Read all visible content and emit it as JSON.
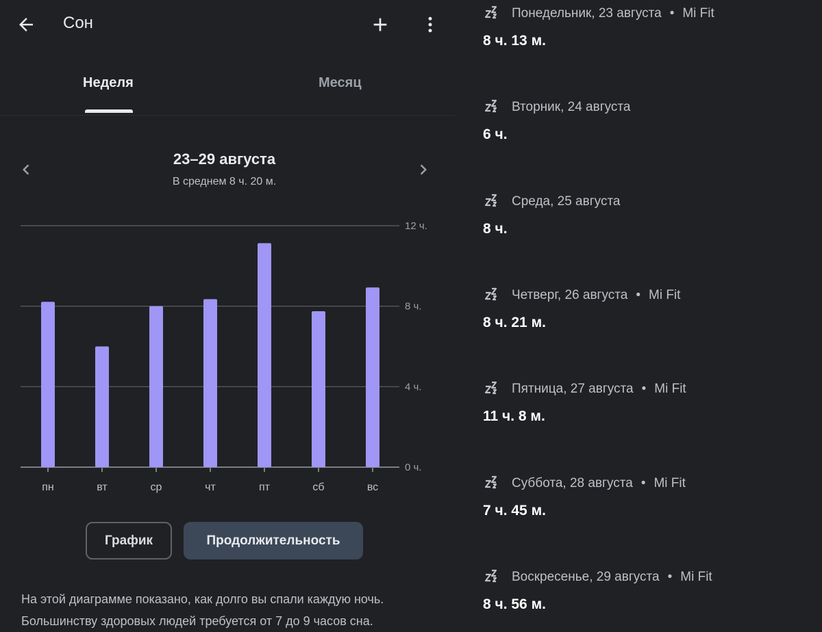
{
  "header": {
    "title": "Сон",
    "back_icon": "arrow-left-icon",
    "add_icon": "plus-icon",
    "more_icon": "more-vert-icon"
  },
  "tabs": [
    {
      "label": "Неделя",
      "selected": true
    },
    {
      "label": "Месяц",
      "selected": false
    }
  ],
  "period": {
    "range": "23–29 августа",
    "average": "В среднем 8 ч. 20 м."
  },
  "chart_data": {
    "type": "bar",
    "categories": [
      "пн",
      "вт",
      "ср",
      "чт",
      "пт",
      "сб",
      "вс"
    ],
    "values": [
      8.217,
      6.0,
      8.0,
      8.35,
      11.133,
      7.75,
      8.933
    ],
    "y_ticks": [
      "12 ч.",
      "8 ч.",
      "4 ч.",
      "0 ч."
    ],
    "y_tick_values": [
      12,
      8,
      4,
      0
    ],
    "ylim": [
      0,
      12
    ],
    "bar_color": "#a096f5",
    "grid_color": "#5f6368",
    "grid": true
  },
  "segmented": {
    "graph_label": "График",
    "duration_label": "Продолжительность",
    "selected": "duration"
  },
  "description": {
    "line1": "На этой диаграмме показано, как долго вы спали каждую ночь.",
    "line2": "Большинству здоровых людей требуется от 7 до 9 часов сна."
  },
  "entries": [
    {
      "date": "Понедельник, 23 августа",
      "source": "Mi Fit",
      "duration": "8 ч. 13 м."
    },
    {
      "date": "Вторник, 24 августа",
      "source": "",
      "duration": "6 ч."
    },
    {
      "date": "Среда, 25 августа",
      "source": "",
      "duration": "8 ч."
    },
    {
      "date": "Четверг, 26 августа",
      "source": "Mi Fit",
      "duration": "8 ч. 21 м."
    },
    {
      "date": "Пятница, 27 августа",
      "source": "Mi Fit",
      "duration": "11 ч. 8 м."
    },
    {
      "date": "Суббота, 28 августа",
      "source": "Mi Fit",
      "duration": "7 ч. 45 м."
    },
    {
      "date": "Воскресенье, 29 августа",
      "source": "Mi Fit",
      "duration": "8 ч. 56 м."
    }
  ],
  "entry_icon": "sleep-zzz-icon",
  "colors": {
    "background": "#202124",
    "accent_bar": "#a096f5",
    "selected_segment": "#3c4758"
  }
}
